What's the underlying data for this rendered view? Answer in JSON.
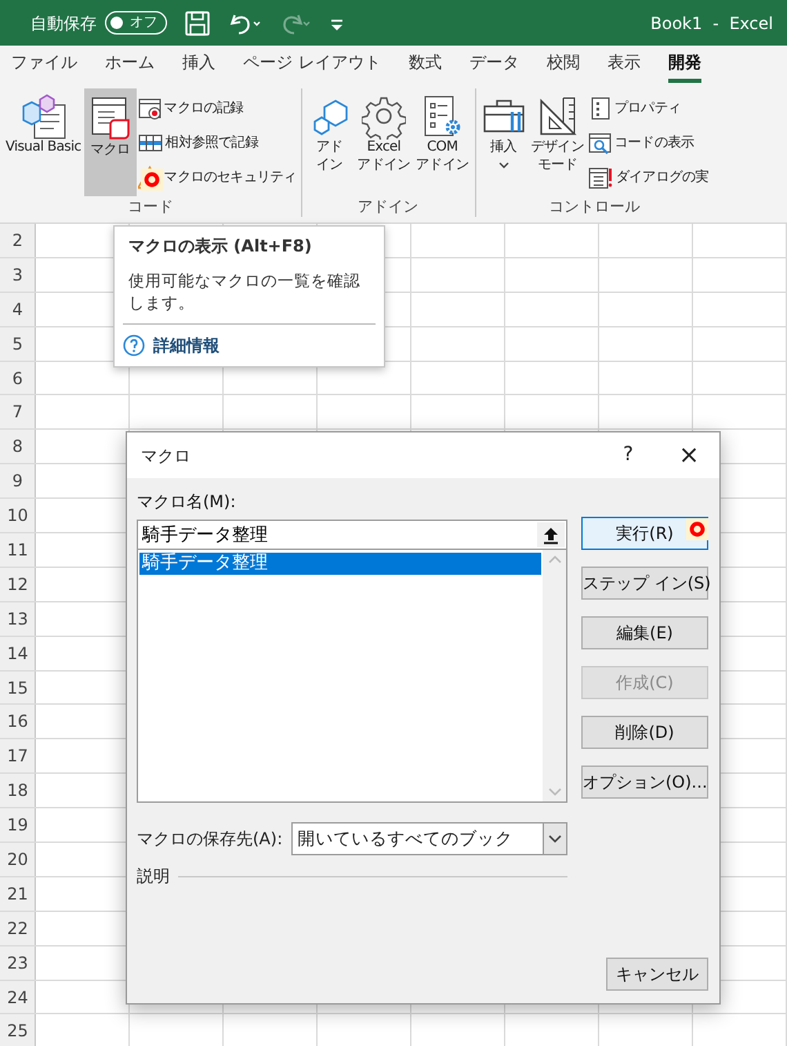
{
  "title_bar": {
    "autosave_label": "自動保存",
    "autosave_toggle": {
      "label": "オフ",
      "on": false
    },
    "quick_access": [
      {
        "kind": "save",
        "disabled": false
      },
      {
        "kind": "undo",
        "disabled": false
      },
      {
        "kind": "redo",
        "disabled": true
      },
      {
        "kind": "customize",
        "disabled": false
      }
    ],
    "document_title": "Book1  -  Excel"
  },
  "tabs": [
    {
      "label": "ファイル",
      "selected": false
    },
    {
      "label": "ホーム",
      "selected": false
    },
    {
      "label": "挿入",
      "selected": false
    },
    {
      "label": "ページ レイアウト",
      "selected": false
    },
    {
      "label": "数式",
      "selected": false
    },
    {
      "label": "データ",
      "selected": false
    },
    {
      "label": "校閲",
      "selected": false
    },
    {
      "label": "表示",
      "selected": false
    },
    {
      "label": "開発",
      "selected": true
    }
  ],
  "ribbon": {
    "groups": [
      {
        "label": "コード",
        "large_buttons": [
          {
            "kind": "visual-basic",
            "label_lines": [
              "Visual Basic"
            ],
            "pressed": false,
            "dropdown": false
          },
          {
            "kind": "macro",
            "label_lines": [
              "マクロ"
            ],
            "pressed": true,
            "dropdown": false
          }
        ],
        "small_buttons": [
          {
            "kind": "record",
            "label": "マクロの記録"
          },
          {
            "kind": "relative",
            "label": "相対参照で記録"
          },
          {
            "kind": "warning",
            "label": "マクロのセキュリティ"
          }
        ]
      },
      {
        "label": "アドイン",
        "large_buttons": [
          {
            "kind": "addin",
            "label_lines": [
              "アド",
              "イン"
            ],
            "pressed": false,
            "dropdown": false
          },
          {
            "kind": "gear",
            "label_lines": [
              "Excel",
              "アドイン"
            ],
            "pressed": false,
            "dropdown": false
          },
          {
            "kind": "com",
            "label_lines": [
              "COM",
              "アドイン"
            ],
            "pressed": false,
            "dropdown": false
          }
        ]
      },
      {
        "label": "コントロール",
        "large_buttons": [
          {
            "kind": "toolbox",
            "label_lines": [
              "挿入"
            ],
            "pressed": false,
            "dropdown": true
          },
          {
            "kind": "ruler",
            "label_lines": [
              "デザイン",
              "モード"
            ],
            "pressed": false,
            "dropdown": false
          }
        ],
        "small_buttons": [
          {
            "kind": "properties",
            "label": "プロパティ"
          },
          {
            "kind": "view-code",
            "label": "コードの表示"
          },
          {
            "kind": "dialog",
            "label": "ダイアログの実"
          }
        ]
      }
    ]
  },
  "sheet": {
    "row_headers": [
      "2",
      "3",
      "4",
      "5",
      "6",
      "7",
      "8",
      "9",
      "10",
      "11",
      "12",
      "13",
      "14",
      "15",
      "16",
      "17",
      "18",
      "19",
      "20",
      "21",
      "22",
      "23",
      "24",
      "25"
    ]
  },
  "tooltip": {
    "title": "マクロの表示 (Alt+F8)",
    "description": "使用可能なマクロの一覧を確認します。",
    "link": "詳細情報"
  },
  "dialog": {
    "title": "マクロ",
    "help": "?",
    "close": "×",
    "name_label": "マクロ名(M):",
    "name_value": "騎手データ整理",
    "macros": [
      {
        "text": "騎手データ整理",
        "selected": true
      }
    ],
    "buttons": [
      {
        "label": "実行(R)",
        "disabled": false,
        "default": true
      },
      {
        "label": "ステップ イン(S)",
        "disabled": false,
        "default": false
      },
      {
        "label": "編集(E)",
        "disabled": false,
        "default": false
      },
      {
        "label": "作成(C)",
        "disabled": true,
        "default": false
      },
      {
        "label": "削除(D)",
        "disabled": false,
        "default": false
      },
      {
        "label": "オプション(O)...",
        "disabled": false,
        "default": false
      }
    ],
    "location_label": "マクロの保存先(A):",
    "location_value": "開いているすべてのブック",
    "description_label": "説明",
    "cancel": "キャンセル"
  }
}
